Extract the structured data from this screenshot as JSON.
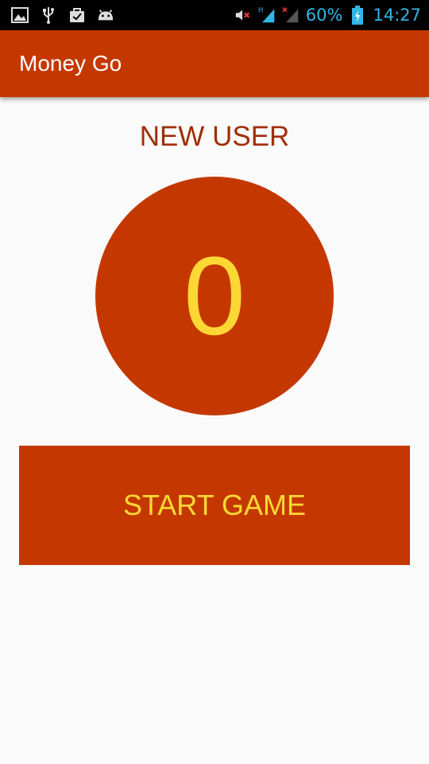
{
  "status_bar": {
    "left_icons": [
      "image-icon",
      "usb-icon",
      "bag-check-icon",
      "android-icon"
    ],
    "right_icons": [
      "mute-icon",
      "signal-h-icon",
      "signal-no-sim-icon",
      "battery-charging-icon"
    ],
    "battery": "60%",
    "time": "14:27",
    "accent_color": "#33b5e5"
  },
  "app_bar": {
    "title": "Money Go",
    "color": "#c43800"
  },
  "main": {
    "user_label": "NEW USER",
    "score": "0",
    "start_button_label": "START GAME",
    "accent_text_color": "#fdd835"
  }
}
